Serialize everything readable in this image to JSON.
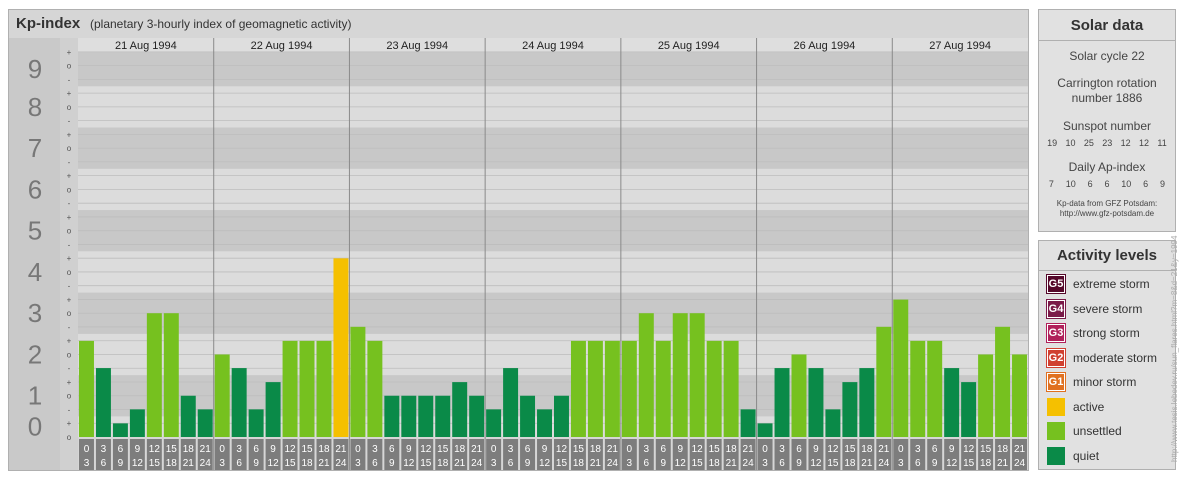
{
  "header": {
    "title": "Kp-index",
    "subtitle": "(planetary 3-hourly index of geomagnetic activity)"
  },
  "chart_data": {
    "type": "bar",
    "days": [
      "21 Aug 1994",
      "22 Aug 1994",
      "23 Aug 1994",
      "24 Aug 1994",
      "25 Aug 1994",
      "26 Aug 1994",
      "27 Aug 1994"
    ],
    "interval_labels": [
      [
        "0",
        "3"
      ],
      [
        "3",
        "6"
      ],
      [
        "6",
        "9"
      ],
      [
        "9",
        "12"
      ],
      [
        "12",
        "15"
      ],
      [
        "15",
        "18"
      ],
      [
        "18",
        "21"
      ],
      [
        "21",
        "24"
      ]
    ],
    "y_major_ticks": [
      "0",
      "1",
      "2",
      "3",
      "4",
      "5",
      "6",
      "7",
      "8",
      "9"
    ],
    "y_minor_marks": [
      "-",
      "o",
      "+"
    ],
    "ylim": [
      0,
      9.33
    ],
    "values": [
      [
        2.33,
        1.67,
        0.33,
        0.67,
        3.0,
        3.0,
        1.0,
        0.67
      ],
      [
        2.0,
        1.67,
        0.67,
        1.33,
        2.33,
        2.33,
        2.33,
        4.33
      ],
      [
        2.67,
        2.33,
        1.0,
        1.0,
        1.0,
        1.0,
        1.33,
        1.0
      ],
      [
        0.67,
        1.67,
        1.0,
        0.67,
        1.0,
        2.33,
        2.33,
        2.33
      ],
      [
        2.33,
        3.0,
        2.33,
        3.0,
        3.0,
        2.33,
        2.33,
        0.67
      ],
      [
        0.33,
        1.67,
        2.0,
        1.67,
        0.67,
        1.33,
        1.67,
        2.67
      ],
      [
        3.33,
        2.33,
        2.33,
        1.67,
        1.33,
        2.0,
        2.67,
        2.0
      ]
    ],
    "grid": true,
    "legend_position": "right"
  },
  "colors": {
    "quiet": "#0a8a48",
    "unsettled": "#76c11f",
    "active": "#f5c000",
    "g1": "#e07020",
    "g2": "#d04030",
    "g3": "#b0205a",
    "g4": "#7a1a48",
    "g5": "#55082a",
    "band_dark": "#c8c8c8",
    "band_light": "#dcdcdc",
    "label_column": "#c9c9c9",
    "interval_cell": "#7d7d7d"
  },
  "solar": {
    "title": "Solar data",
    "cycle": "Solar cycle 22",
    "carrington_line1": "Carrington rotation",
    "carrington_line2": "number 1886",
    "sunspot_title": "Sunspot number",
    "sunspot_values": [
      "19",
      "10",
      "25",
      "23",
      "12",
      "12",
      "11"
    ],
    "ap_title": "Daily Ap-index",
    "ap_values": [
      "7",
      "10",
      "6",
      "6",
      "10",
      "6",
      "9"
    ],
    "credit_line1": "Kp-data from GFZ Potsdam:",
    "credit_line2": "http://www.gfz-potsdam.de"
  },
  "activity": {
    "title": "Activity levels",
    "levels": [
      {
        "code": "G5",
        "label": "extreme storm",
        "color": "#55082a"
      },
      {
        "code": "G4",
        "label": "severe storm",
        "color": "#7a1a48"
      },
      {
        "code": "G3",
        "label": "strong storm",
        "color": "#b0205a"
      },
      {
        "code": "G2",
        "label": "moderate storm",
        "color": "#d04030"
      },
      {
        "code": "G1",
        "label": "minor storm",
        "color": "#e07020"
      },
      {
        "code": "",
        "label": "active",
        "color": "#f5c000"
      },
      {
        "code": "",
        "label": "unsettled",
        "color": "#76c11f"
      },
      {
        "code": "",
        "label": "quiet",
        "color": "#0a8a48"
      }
    ]
  },
  "watermark": "http://www.tesis.lebedev.ru/sun_flares.html?m=8&d=21&y=1994"
}
